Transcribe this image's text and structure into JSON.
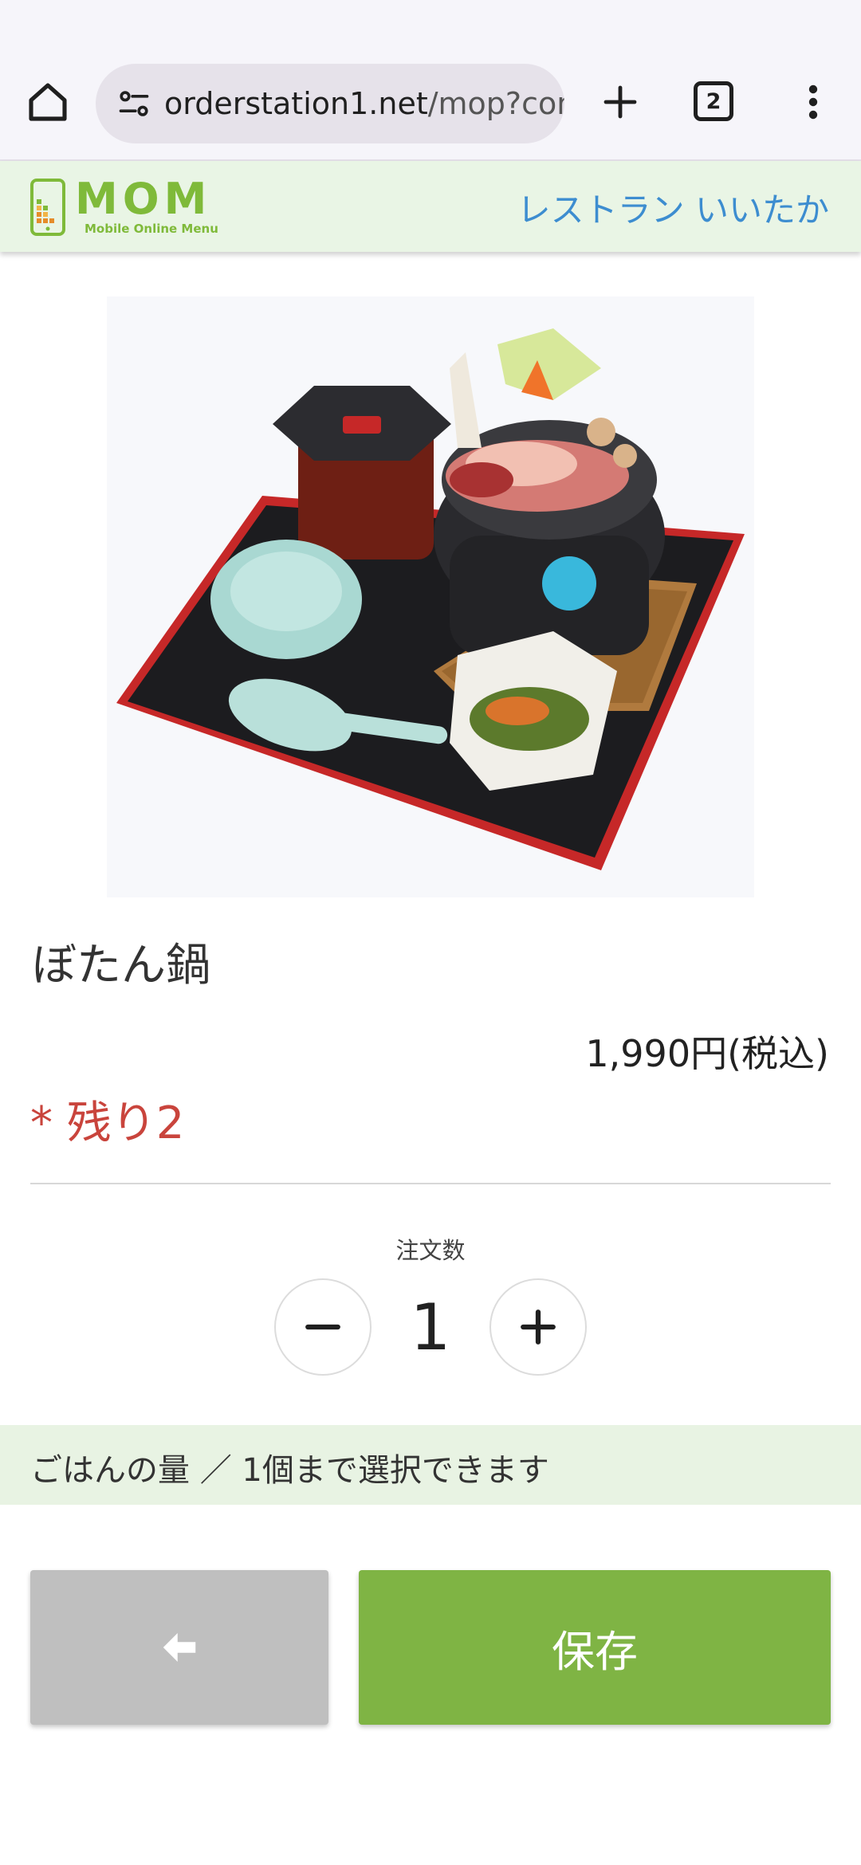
{
  "browser": {
    "url_domain": "orderstation1.net",
    "url_path": "/mop?com",
    "tab_count": "2",
    "icons": [
      "home-icon",
      "site-settings-icon",
      "plus-icon",
      "tab-switcher-icon",
      "more-vert-icon"
    ]
  },
  "header": {
    "logo_text": "MOM",
    "logo_tagline": "Mobile Online Menu",
    "restaurant_name": "レストラン いいたか",
    "brand_color": "#7fba3a",
    "link_color": "#3d8dd0"
  },
  "product": {
    "name": "ぼたん鍋",
    "price": "1,990円(税込)",
    "stock_note": "* 残り2",
    "stock_color": "#c9443c"
  },
  "quantity": {
    "label": "注文数",
    "value": "1"
  },
  "option": {
    "text": "ごはんの量 ／ 1個まで選択できます"
  },
  "actions": {
    "back_icon": "arrow-left-icon",
    "save_label": "保存",
    "save_color": "#7fb444"
  }
}
